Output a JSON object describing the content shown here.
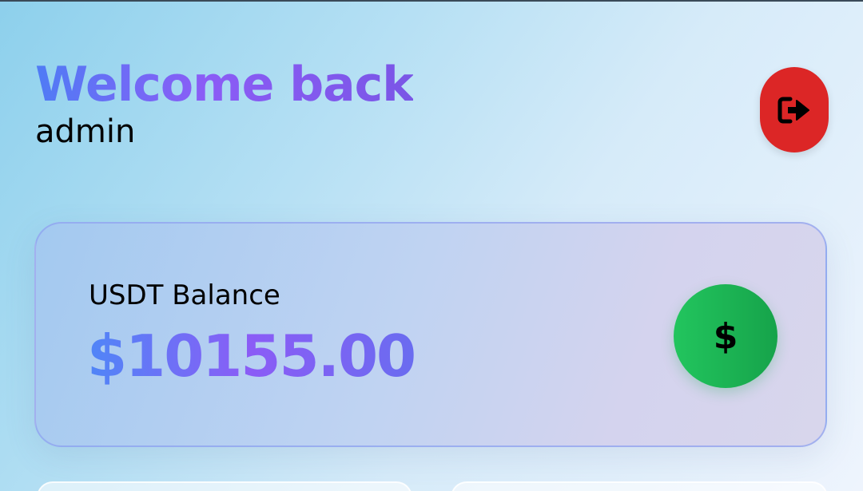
{
  "header": {
    "welcome_text": "Welcome back",
    "username": "admin"
  },
  "logout_button": {
    "icon": "logout-icon",
    "color": "#dc2626"
  },
  "balance_card": {
    "label": "USDT Balance",
    "value": "$10155.00",
    "badge_icon": "dollar-icon",
    "badge_glyph": "$",
    "badge_color": "#16a34a"
  },
  "colors": {
    "accent_gradient_start": "#4f7cf5",
    "accent_gradient_end": "#8b5cf6"
  }
}
